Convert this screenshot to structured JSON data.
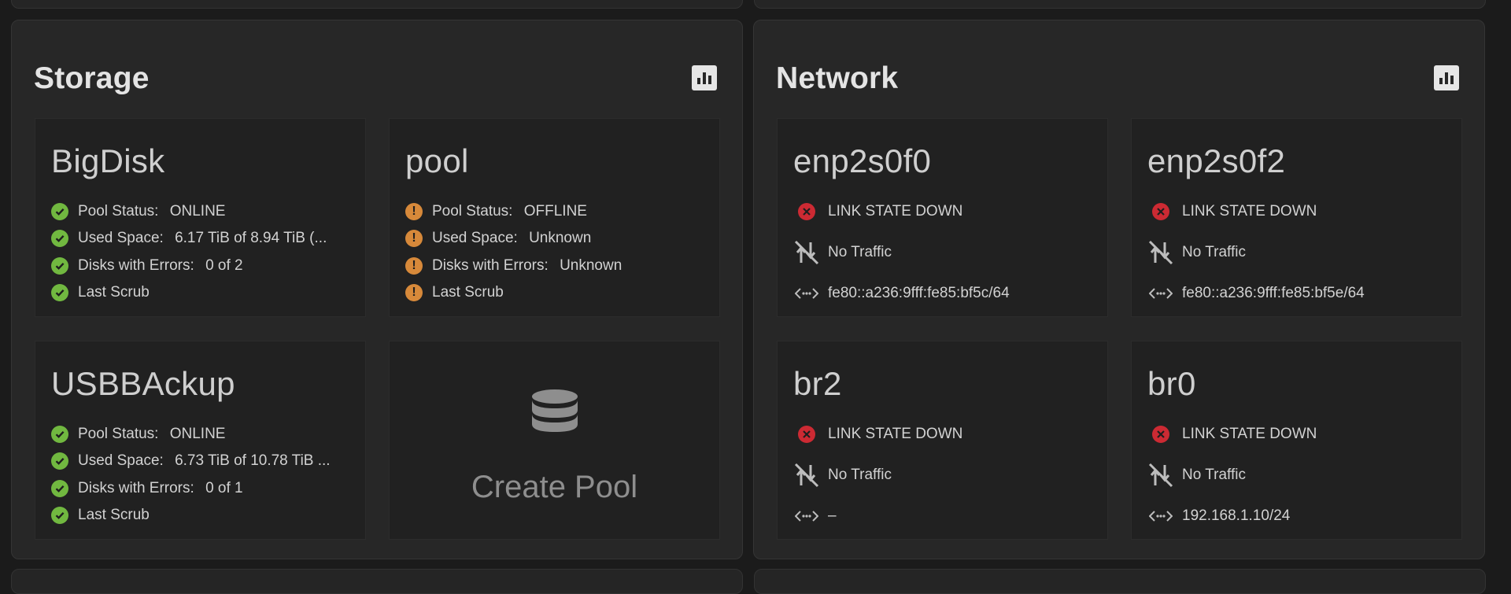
{
  "storage": {
    "title": "Storage",
    "pools": [
      {
        "name": "BigDisk",
        "rows": [
          {
            "status": "ok",
            "label": "Pool Status: ",
            "value": "ONLINE"
          },
          {
            "status": "ok",
            "label": "Used Space: ",
            "value": "6.17 TiB of 8.94 TiB (..."
          },
          {
            "status": "ok",
            "label": "Disks with Errors: ",
            "value": "0 of 2"
          },
          {
            "status": "ok",
            "label": "Last Scrub",
            "value": ""
          }
        ]
      },
      {
        "name": "pool",
        "rows": [
          {
            "status": "warn",
            "label": "Pool Status: ",
            "value": "OFFLINE"
          },
          {
            "status": "warn",
            "label": "Used Space: ",
            "value": "Unknown"
          },
          {
            "status": "warn",
            "label": "Disks with Errors: ",
            "value": "Unknown"
          },
          {
            "status": "warn",
            "label": "Last Scrub",
            "value": ""
          }
        ]
      },
      {
        "name": "USBBAckup",
        "rows": [
          {
            "status": "ok",
            "label": "Pool Status: ",
            "value": "ONLINE"
          },
          {
            "status": "ok",
            "label": "Used Space: ",
            "value": "6.73 TiB of 10.78 TiB ..."
          },
          {
            "status": "ok",
            "label": "Disks with Errors: ",
            "value": "0 of 1"
          },
          {
            "status": "ok",
            "label": "Last Scrub",
            "value": ""
          }
        ]
      }
    ],
    "create_pool_label": "Create Pool"
  },
  "network": {
    "title": "Network",
    "interfaces": [
      {
        "name": "enp2s0f0",
        "link_state": "LINK STATE DOWN",
        "traffic": "No Traffic",
        "address": "fe80::a236:9fff:fe85:bf5c/64"
      },
      {
        "name": "enp2s0f2",
        "link_state": "LINK STATE DOWN",
        "traffic": "No Traffic",
        "address": "fe80::a236:9fff:fe85:bf5e/64"
      },
      {
        "name": "br2",
        "link_state": "LINK STATE DOWN",
        "traffic": "No Traffic",
        "address": "–"
      },
      {
        "name": "br0",
        "link_state": "LINK STATE DOWN",
        "traffic": "No Traffic",
        "address": "192.168.1.10/24"
      }
    ]
  },
  "colors": {
    "ok": "#71b840",
    "warn": "#d7893a",
    "error": "#cc2a33"
  },
  "icons": {
    "ok": "check-circle-icon",
    "warn": "alert-circle-icon",
    "error": "close-circle-icon",
    "traffic": "no-traffic-icon",
    "address": "ip-address-icon",
    "chart": "bar-chart-icon",
    "database": "database-icon"
  }
}
